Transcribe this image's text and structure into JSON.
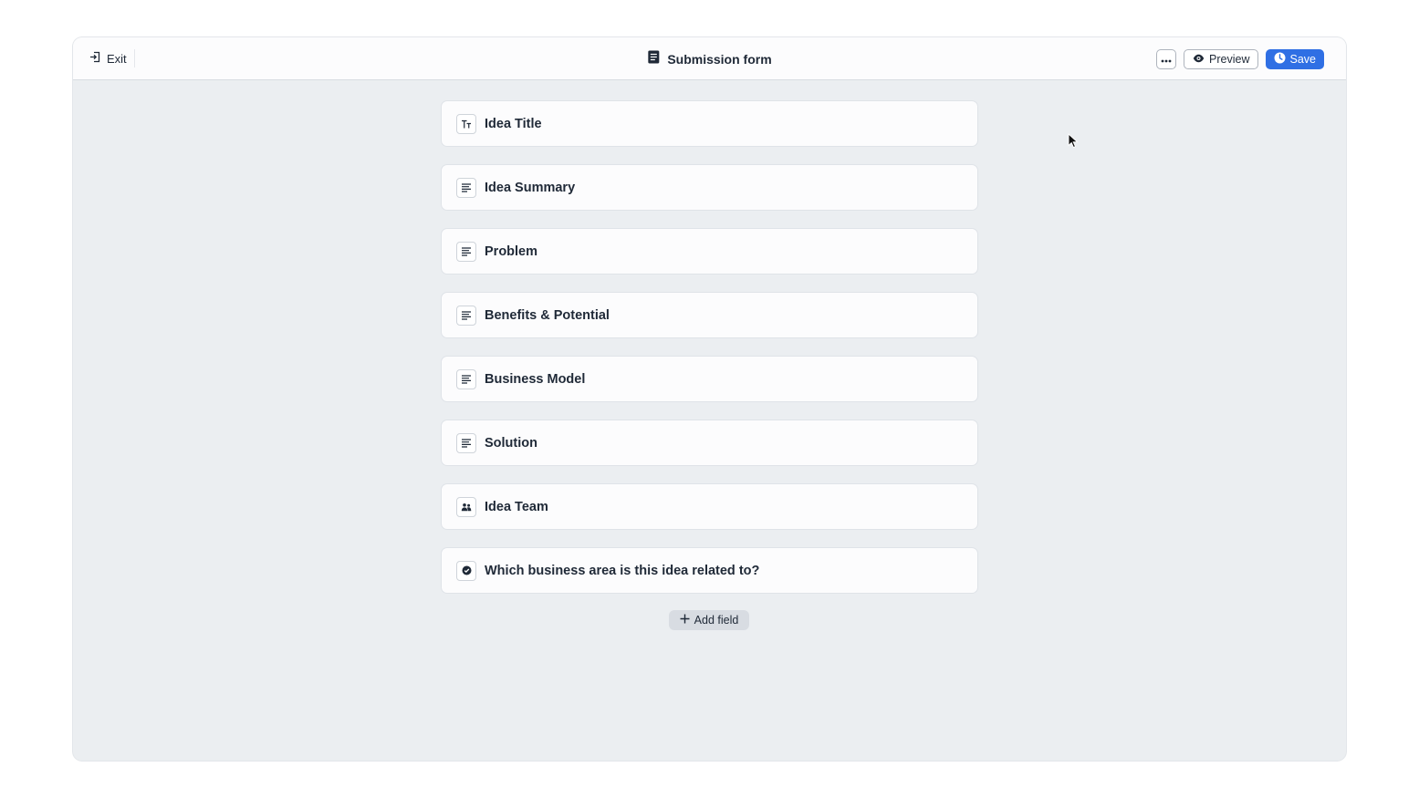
{
  "header": {
    "exit_label": "Exit",
    "title": "Submission form",
    "preview_label": "Preview",
    "save_label": "Save"
  },
  "fields": [
    {
      "label": "Idea Title",
      "icon": "text-type-icon"
    },
    {
      "label": "Idea Summary",
      "icon": "paragraph-icon"
    },
    {
      "label": "Problem",
      "icon": "paragraph-icon"
    },
    {
      "label": "Benefits & Potential",
      "icon": "paragraph-icon"
    },
    {
      "label": "Business Model",
      "icon": "paragraph-icon"
    },
    {
      "label": "Solution",
      "icon": "paragraph-icon"
    },
    {
      "label": "Idea Team",
      "icon": "people-icon"
    },
    {
      "label": "Which business area is this idea related to?",
      "icon": "check-circle-icon"
    }
  ],
  "add_field_label": "Add field",
  "colors": {
    "accent": "#2f6fe4",
    "canvas": "#ebeef1",
    "card": "#fcfcfd",
    "text": "#1f2937"
  }
}
